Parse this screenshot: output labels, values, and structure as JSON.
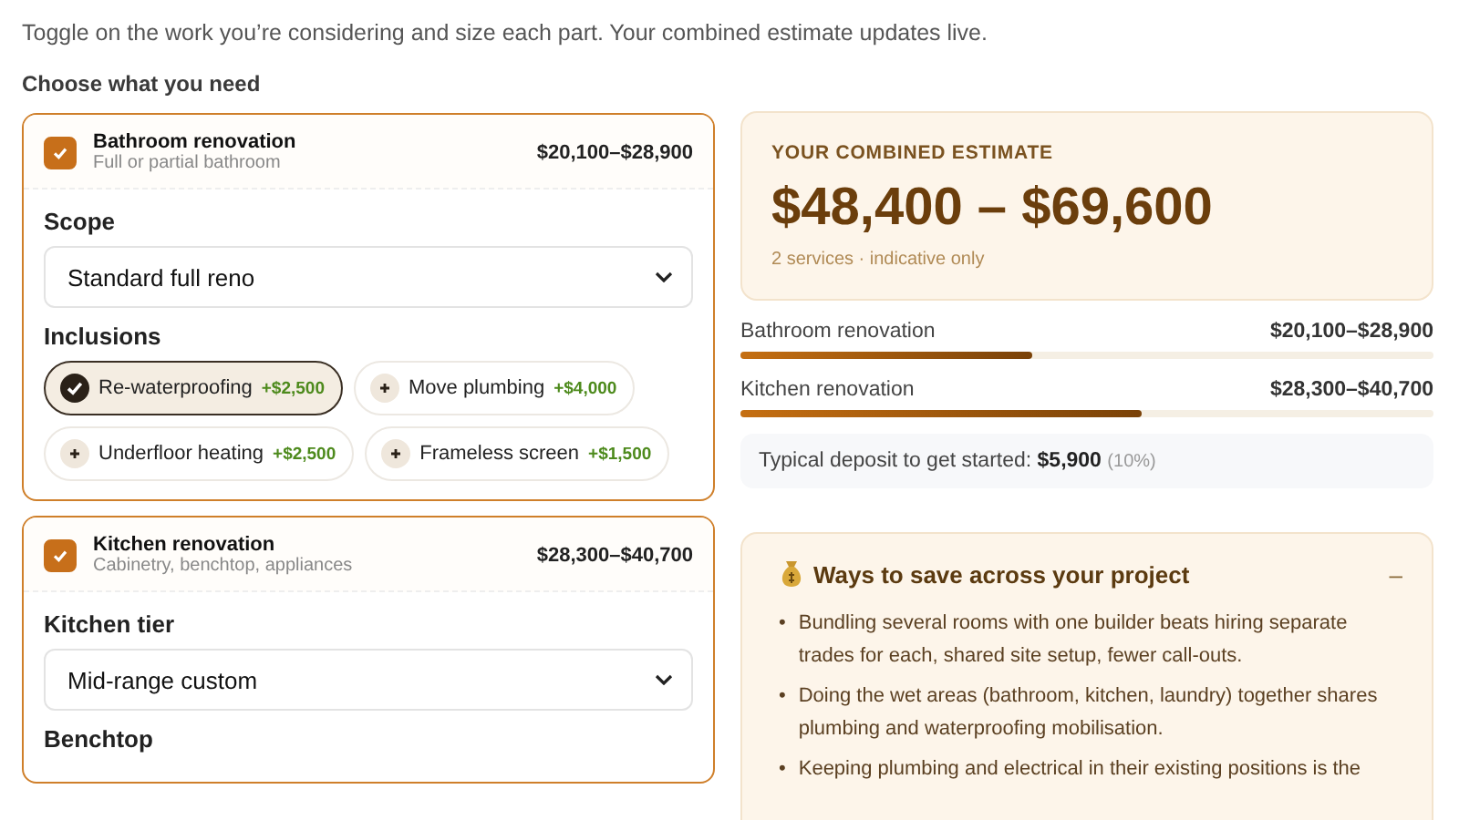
{
  "intro": "Toggle on the work you’re considering and size each part. Your combined estimate updates live.",
  "section_label": "Choose what you need",
  "services": [
    {
      "name": "Bathroom renovation",
      "subtitle": "Full or partial bathroom",
      "checked": true,
      "range": "$20,100–$28,900",
      "fields": [
        {
          "kind": "select",
          "label": "Scope",
          "value": "Standard full reno"
        },
        {
          "kind": "chips",
          "label": "Inclusions",
          "options": [
            {
              "label": "Re-waterproofing",
              "price": "+$2,500",
              "selected": true
            },
            {
              "label": "Move plumbing",
              "price": "+$4,000",
              "selected": false
            },
            {
              "label": "Underfloor heating",
              "price": "+$2,500",
              "selected": false
            },
            {
              "label": "Frameless screen",
              "price": "+$1,500",
              "selected": false
            }
          ]
        }
      ]
    },
    {
      "name": "Kitchen renovation",
      "subtitle": "Cabinetry, benchtop, appliances",
      "checked": true,
      "range": "$28,300–$40,700",
      "fields": [
        {
          "kind": "select",
          "label": "Kitchen tier",
          "value": "Mid-range custom"
        },
        {
          "kind": "heading",
          "label": "Benchtop"
        }
      ]
    }
  ],
  "estimate": {
    "title": "YOUR COMBINED ESTIMATE",
    "range": "$48,400 – $69,600",
    "note": "2 services · indicative only"
  },
  "breakdown": [
    {
      "name": "Bathroom renovation",
      "range": "$20,100–$28,900",
      "level": 0.42
    },
    {
      "name": "Kitchen renovation",
      "range": "$28,300–$40,700",
      "level": 0.58
    }
  ],
  "deposit": {
    "text": "Typical deposit to get started:",
    "amount": "$5,900",
    "percent": "(10%)"
  },
  "tips": {
    "title": "Ways to save across your project",
    "toggle": "–",
    "expanded": true,
    "bullet": "•",
    "items": [
      "Bundling several rooms with one builder beats hiring separate trades for each, shared site setup, fewer call-outs.",
      "Doing the wet areas (bathroom, kitchen, laundry) together shares plumbing and waterproofing mobilisation.",
      "Keeping plumbing and electrical in their existing positions is the"
    ]
  }
}
